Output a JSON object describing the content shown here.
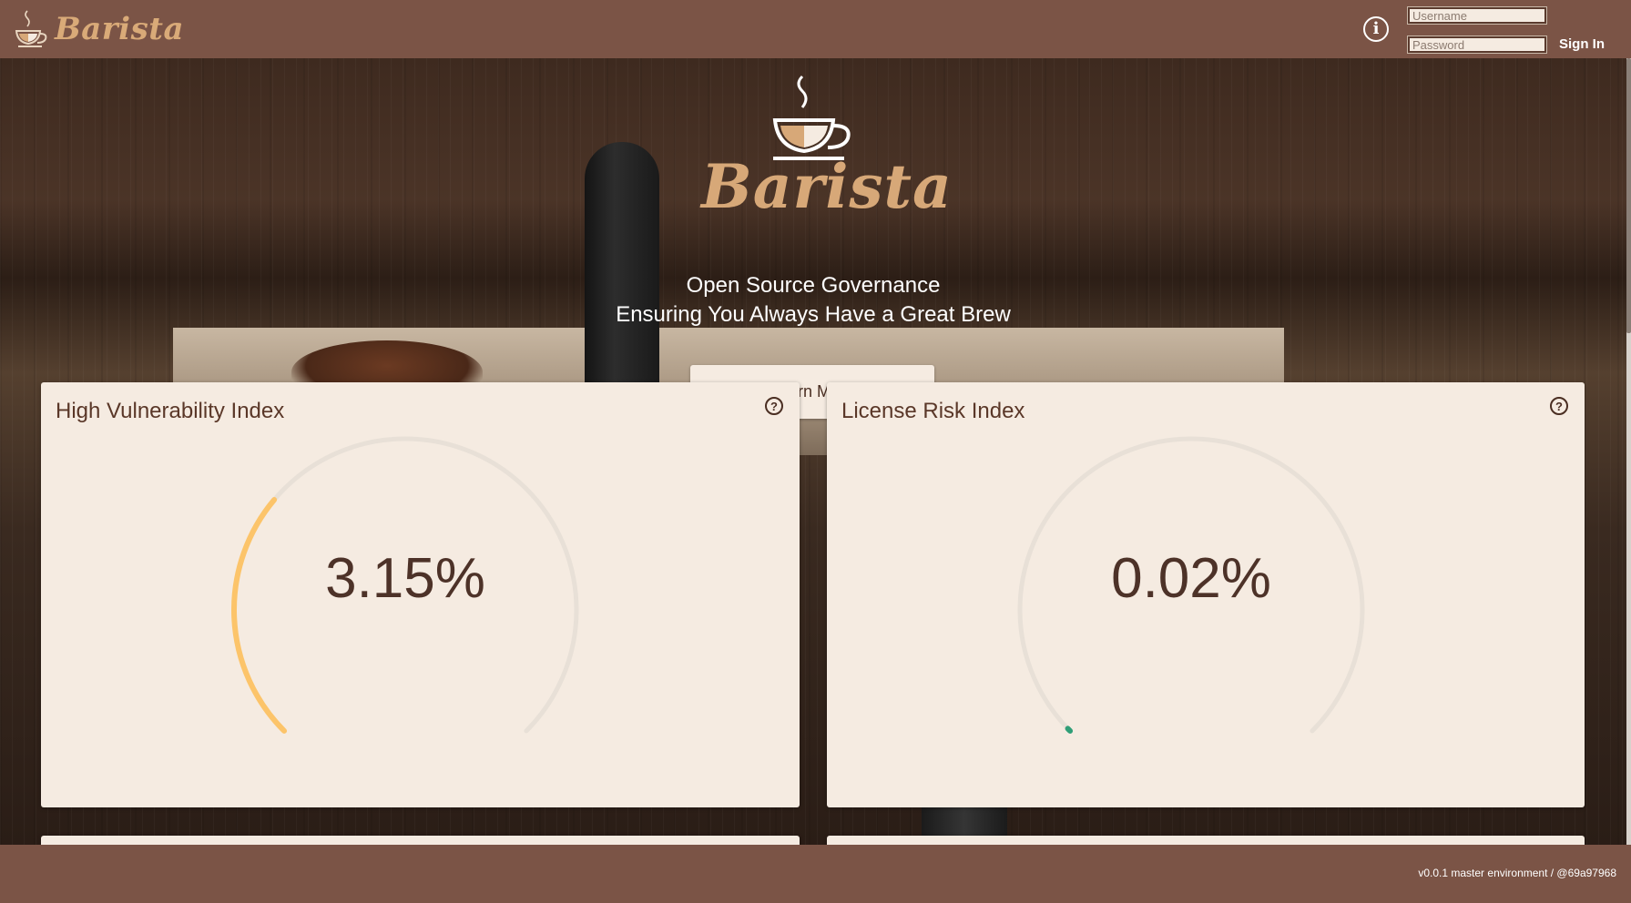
{
  "header": {
    "brand": "Barista",
    "username_placeholder": "Username",
    "password_placeholder": "Password",
    "signin_label": "Sign In"
  },
  "hero": {
    "brand": "Barista",
    "tagline_1": "Open Source Governance",
    "tagline_2": "Ensuring You Always Have a Great Brew",
    "learn_more_label": "Learn More"
  },
  "cards": [
    {
      "title": "High Vulnerability Index",
      "value": "3.15%",
      "fraction": 0.0315,
      "color": "#fcc46a"
    },
    {
      "title": "License Risk Index",
      "value": "0.02%",
      "fraction": 0.0002,
      "color": "#2f9e77"
    }
  ],
  "footer": {
    "version": "v0.0.1 master environment / @69a97968"
  },
  "colors": {
    "bar": "#7b5446",
    "card": "#f5ebe1",
    "brand_text": "#d7a878",
    "gauge_track": "#e8e0d7"
  }
}
